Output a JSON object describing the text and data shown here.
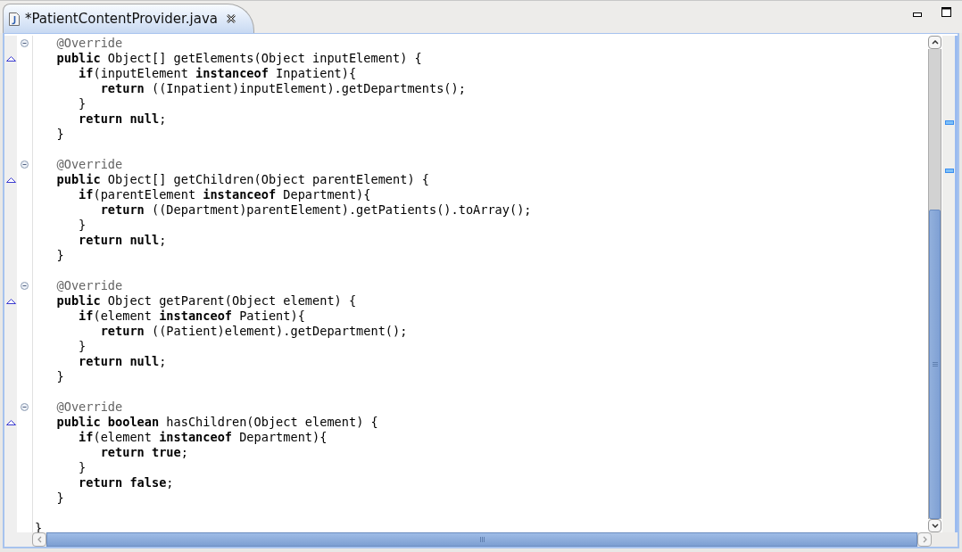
{
  "tab": {
    "title": "*PatientContentProvider.java",
    "selected": true
  },
  "lines": [
    {
      "text": "   @Override",
      "kind": "annotation",
      "fold": true,
      "override": false
    },
    {
      "text": "   **public** Object[] getElements(Object inputElement) {",
      "kind": "code",
      "fold": false,
      "override": true
    },
    {
      "text": "      **if**(inputElement **instanceof** Inpatient){",
      "kind": "code",
      "fold": false,
      "override": false
    },
    {
      "text": "         **return** ((Inpatient)inputElement).getDepartments();",
      "kind": "code",
      "fold": false,
      "override": false
    },
    {
      "text": "      }",
      "kind": "code",
      "fold": false,
      "override": false
    },
    {
      "text": "      **return** **null**;",
      "kind": "code",
      "fold": false,
      "override": false
    },
    {
      "text": "   }",
      "kind": "code",
      "fold": false,
      "override": false
    },
    {
      "kind": "blank",
      "fold": false,
      "override": false
    },
    {
      "text": "   @Override",
      "kind": "annotation",
      "fold": true,
      "override": false
    },
    {
      "text": "   **public** Object[] getChildren(Object parentElement) {",
      "kind": "code",
      "fold": false,
      "override": true
    },
    {
      "text": "      **if**(parentElement **instanceof** Department){",
      "kind": "code",
      "fold": false,
      "override": false
    },
    {
      "text": "         **return** ((Department)parentElement).getPatients().toArray();",
      "kind": "code",
      "fold": false,
      "override": false
    },
    {
      "text": "      }",
      "kind": "code",
      "fold": false,
      "override": false
    },
    {
      "text": "      **return** **null**;",
      "kind": "code",
      "fold": false,
      "override": false
    },
    {
      "text": "   }",
      "kind": "code",
      "fold": false,
      "override": false
    },
    {
      "kind": "blank",
      "fold": false,
      "override": false
    },
    {
      "text": "   @Override",
      "kind": "annotation",
      "fold": true,
      "override": false
    },
    {
      "text": "   **public** Object getParent(Object element) {",
      "kind": "code",
      "fold": false,
      "override": true
    },
    {
      "text": "      **if**(element **instanceof** Patient){",
      "kind": "code",
      "fold": false,
      "override": false
    },
    {
      "text": "         **return** ((Patient)element).getDepartment();",
      "kind": "code",
      "fold": false,
      "override": false
    },
    {
      "text": "      }",
      "kind": "code",
      "fold": false,
      "override": false
    },
    {
      "text": "      **return** **null**;",
      "kind": "code",
      "fold": false,
      "override": false
    },
    {
      "text": "   }",
      "kind": "code",
      "fold": false,
      "override": false
    },
    {
      "kind": "blank",
      "fold": false,
      "override": false
    },
    {
      "text": "   @Override",
      "kind": "annotation",
      "fold": true,
      "override": false
    },
    {
      "text": "   **public** **boolean** hasChildren(Object element) {",
      "kind": "code",
      "fold": false,
      "override": true
    },
    {
      "text": "      **if**(element **instanceof** Department){",
      "kind": "code",
      "fold": false,
      "override": false
    },
    {
      "text": "         **return** **true**;",
      "kind": "code",
      "fold": false,
      "override": false
    },
    {
      "text": "      }",
      "kind": "code",
      "fold": false,
      "override": false
    },
    {
      "text": "      **return** **false**;",
      "kind": "code",
      "fold": false,
      "override": false
    },
    {
      "text": "   }",
      "kind": "code",
      "fold": false,
      "override": false
    },
    {
      "kind": "blank",
      "fold": false,
      "override": false
    },
    {
      "text": "}",
      "kind": "code",
      "fold": false,
      "override": false
    }
  ]
}
